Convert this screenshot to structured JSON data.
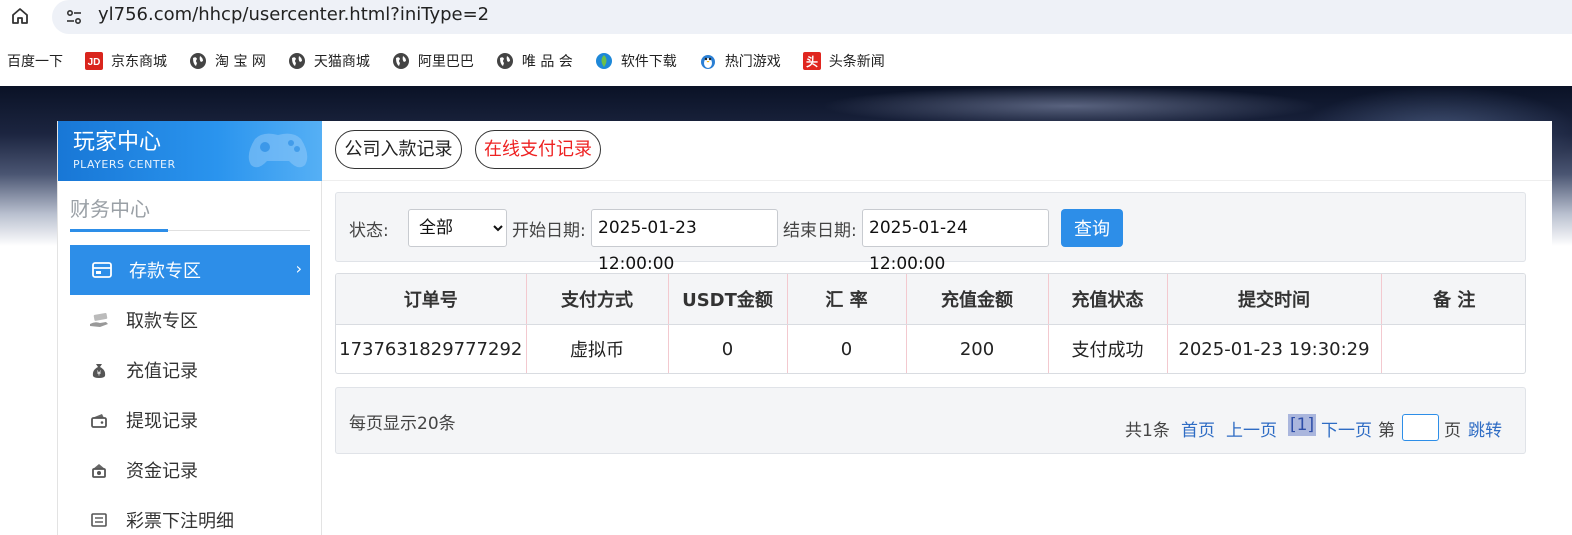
{
  "browser": {
    "url": "yl756.com/hhcp/usercenter.html?iniType=2",
    "bookmarks": [
      {
        "label": "百度一下",
        "icon": "none"
      },
      {
        "label": "京东商城",
        "icon": "jd-icon"
      },
      {
        "label": "淘 宝 网",
        "icon": "globe-icon"
      },
      {
        "label": "天猫商城",
        "icon": "globe-icon"
      },
      {
        "label": "阿里巴巴",
        "icon": "globe-icon"
      },
      {
        "label": "唯 品 会",
        "icon": "globe-icon"
      },
      {
        "label": "软件下载",
        "icon": "leaf-icon"
      },
      {
        "label": "热门游戏",
        "icon": "penguin-icon"
      },
      {
        "label": "头条新闻",
        "icon": "toutiao-icon"
      }
    ],
    "jd_logo_text": "JD",
    "toutiao_logo_text": "头"
  },
  "sidebar": {
    "title": "玩家中心",
    "subtitle": "PLAYERS CENTER",
    "section": "财务中心",
    "items": [
      {
        "label": "存款专区",
        "icon": "card-icon",
        "active": true
      },
      {
        "label": "取款专区",
        "icon": "cash-hand-icon",
        "active": false
      },
      {
        "label": "充值记录",
        "icon": "money-bag-icon",
        "active": false
      },
      {
        "label": "提现记录",
        "icon": "wallet-icon",
        "active": false
      },
      {
        "label": "资金记录",
        "icon": "coins-icon",
        "active": false
      },
      {
        "label": "彩票下注明细",
        "icon": "list-icon",
        "active": false
      }
    ],
    "active_chevron": "›"
  },
  "tabs": {
    "company_deposit": "公司入款记录",
    "online_payment": "在线支付记录"
  },
  "filter": {
    "status_label": "状态:",
    "status_value": "全部",
    "start_label": "开始日期:",
    "start_value": "2025-01-23 12:00:00",
    "end_label": "结束日期:",
    "end_value": "2025-01-24 12:00:00",
    "query_button": "查询"
  },
  "table": {
    "headers": [
      "订单号",
      "支付方式",
      "USDT金额",
      "汇 率",
      "充值金额",
      "充值状态",
      "提交时间",
      "备 注"
    ],
    "rows": [
      [
        "1737631829777292",
        "虚拟币",
        "0",
        "0",
        "200",
        "支付成功",
        "2025-01-23 19:30:29",
        ""
      ]
    ]
  },
  "pager": {
    "per_page": "每页显示20条",
    "total": "共1条",
    "first": "首页",
    "prev": "上一页",
    "current": "[1]",
    "next": "下一页",
    "page_prefix": "第",
    "page_suffix": "页",
    "goto": "跳转"
  },
  "colors": {
    "accent": "#2d8ee8",
    "link": "#2e6cc4",
    "alert_red": "#e22222"
  }
}
